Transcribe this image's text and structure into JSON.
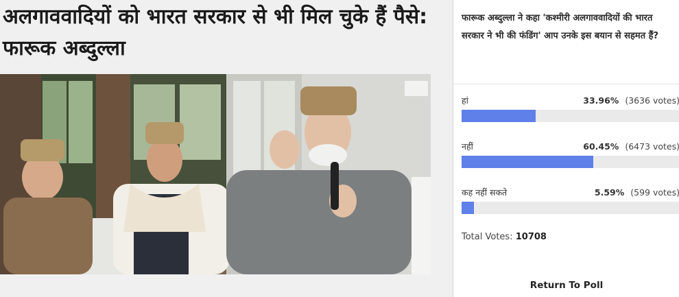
{
  "article": {
    "headline": "अलगाववादियों को भारत सरकार से भी मिल चुके हैं पैसे: फारूक अब्दुल्ला"
  },
  "poll": {
    "question": "फारूक अब्दुल्ला ने कहा 'कश्मीरी अलगाववादियों की भारत सरकार ने भी की फंडिंग' आप उनके इस बयान से सहमत हैं?",
    "options": [
      {
        "label": "हां",
        "percent_text": "33.96%",
        "votes_text": "(3636 votes)",
        "percent": 33.96,
        "color": "#5e80e8"
      },
      {
        "label": "नहीं",
        "percent_text": "60.45%",
        "votes_text": "(6473 votes)",
        "percent": 60.45,
        "color": "#5e80e8"
      },
      {
        "label": "कह नहीं सकते",
        "percent_text": "5.59%",
        "votes_text": "(599 votes)",
        "percent": 5.59,
        "color": "#5e80e8"
      }
    ],
    "total_label": "Total Votes:",
    "total_value": "10708",
    "return_label": "Return To Poll"
  }
}
